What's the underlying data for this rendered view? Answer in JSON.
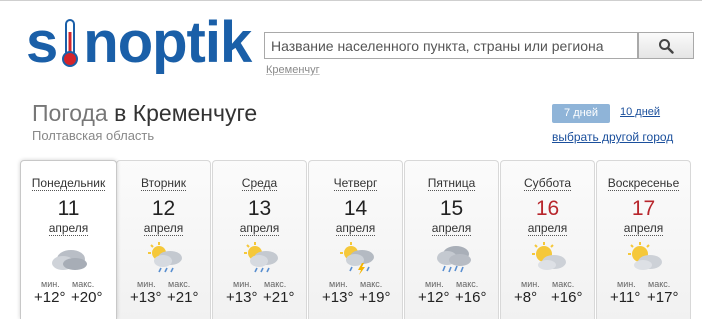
{
  "logo": {
    "text_left": "s",
    "text_right": "noptik"
  },
  "search": {
    "placeholder": "Название населенного пункта, страны или региона",
    "hint": "Кременчуг"
  },
  "header": {
    "title_prefix": "Погода",
    "title_city": "в Кременчуге",
    "region": "Полтавская область"
  },
  "tabs": {
    "seven": "7 дней",
    "ten": "10 дней",
    "pick_city": "выбрать другой город"
  },
  "labels": {
    "min": "мин.",
    "max": "макс."
  },
  "days": [
    {
      "name": "Понедельник",
      "num": "11",
      "month": "апреля",
      "min": "+12°",
      "max": "+20°",
      "icon": "cloudy-icon",
      "weekend": false
    },
    {
      "name": "Вторник",
      "num": "12",
      "month": "апреля",
      "min": "+13°",
      "max": "+21°",
      "icon": "partly-cloudy-rain-icon",
      "weekend": false
    },
    {
      "name": "Среда",
      "num": "13",
      "month": "апреля",
      "min": "+13°",
      "max": "+21°",
      "icon": "partly-cloudy-rain-icon",
      "weekend": false
    },
    {
      "name": "Четверг",
      "num": "14",
      "month": "апреля",
      "min": "+13°",
      "max": "+19°",
      "icon": "thunderstorm-sun-icon",
      "weekend": false
    },
    {
      "name": "Пятница",
      "num": "15",
      "month": "апреля",
      "min": "+12°",
      "max": "+16°",
      "icon": "cloudy-rain-icon",
      "weekend": false
    },
    {
      "name": "Суббота",
      "num": "16",
      "month": "апреля",
      "min": "+8°",
      "max": "+16°",
      "icon": "partly-cloudy-icon",
      "weekend": true
    },
    {
      "name": "Воскресенье",
      "num": "17",
      "month": "апреля",
      "min": "+11°",
      "max": "+17°",
      "icon": "partly-cloudy-icon",
      "weekend": true
    }
  ],
  "colors": {
    "brand": "#1a5fa8",
    "weekend": "#b8262c",
    "active_tab": "#8fb4d8",
    "link": "#1a4f9c"
  }
}
